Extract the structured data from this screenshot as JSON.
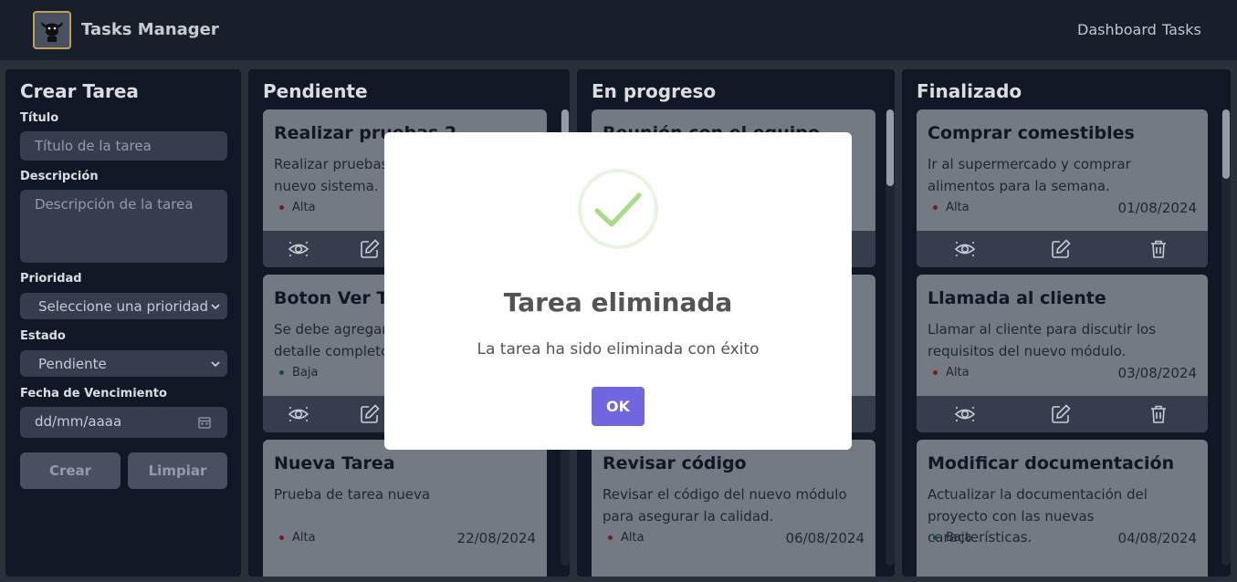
{
  "header": {
    "app_title": "Tasks Manager",
    "nav": [
      "Dashboard",
      "Tasks"
    ],
    "logo_icon": "bull-logo-icon"
  },
  "form": {
    "title": "Crear Tarea",
    "title_label": "Título",
    "title_placeholder": "Título de la tarea",
    "description_label": "Descripción",
    "description_placeholder": "Descripción de la tarea",
    "priority_label": "Prioridad",
    "priority_value": "Seleccione una prioridad",
    "status_label": "Estado",
    "status_value": "Pendiente",
    "due_label": "Fecha de Vencimiento",
    "due_placeholder": "dd/mm/aaaa",
    "create_label": "Crear",
    "clear_label": "Limpiar"
  },
  "columns": [
    {
      "title": "Pendiente",
      "cards": [
        {
          "title": "Realizar pruebas 2",
          "description": "Realizar pruebas de integración del nuevo sistema.",
          "priority": "Alta",
          "date": ""
        },
        {
          "title": "Boton Ver Tarea",
          "description": "Se debe agregar un botón para ver el detalle completo de la tarea.",
          "priority": "Baja",
          "date": ""
        },
        {
          "title": "Nueva Tarea",
          "description": "Prueba de tarea nueva",
          "priority": "Alta",
          "date": "22/08/2024"
        }
      ]
    },
    {
      "title": "En progreso",
      "cards": [
        {
          "title": "Reunión con el equipo",
          "description": "",
          "priority": "",
          "date": ""
        },
        {
          "title": "",
          "description": "",
          "priority": "",
          "date": ""
        },
        {
          "title": "Revisar código",
          "description": "Revisar el código del nuevo módulo para asegurar la calidad.",
          "priority": "Alta",
          "date": "06/08/2024"
        }
      ]
    },
    {
      "title": "Finalizado",
      "cards": [
        {
          "title": "Comprar comestibles",
          "description": "Ir al supermercado y comprar alimentos para la semana.",
          "priority": "Alta",
          "date": "01/08/2024"
        },
        {
          "title": "Llamada al cliente",
          "description": "Llamar al cliente para discutir los requisitos del nuevo módulo.",
          "priority": "Alta",
          "date": "03/08/2024"
        },
        {
          "title": "Modificar documentación",
          "description": "Actualizar la documentación del proyecto con las nuevas características.",
          "priority": "Baja",
          "date": "04/08/2024"
        }
      ]
    }
  ],
  "modal": {
    "title": "Tarea eliminada",
    "text": "La tarea ha sido eliminada con éxito",
    "ok_label": "OK",
    "icon": "success-check-icon"
  },
  "colors": {
    "accent": "#7066e0",
    "success": "#a5dc86",
    "priority_alta": "#7f1d1d",
    "priority_baja": "#14532d"
  }
}
